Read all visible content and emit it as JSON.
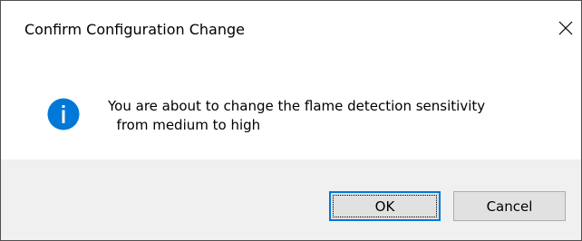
{
  "dialog": {
    "title": "Confirm Configuration Change",
    "close_icon": "close-icon",
    "message_line1": "You are about to change the flame detection sensitivity",
    "message_line2": "  from medium to high",
    "icon": "info-icon",
    "icon_color": "#0078d7",
    "buttons": {
      "ok_label": "OK",
      "cancel_label": "Cancel"
    },
    "default_button": "OK",
    "accent_color": "#0078d7"
  }
}
